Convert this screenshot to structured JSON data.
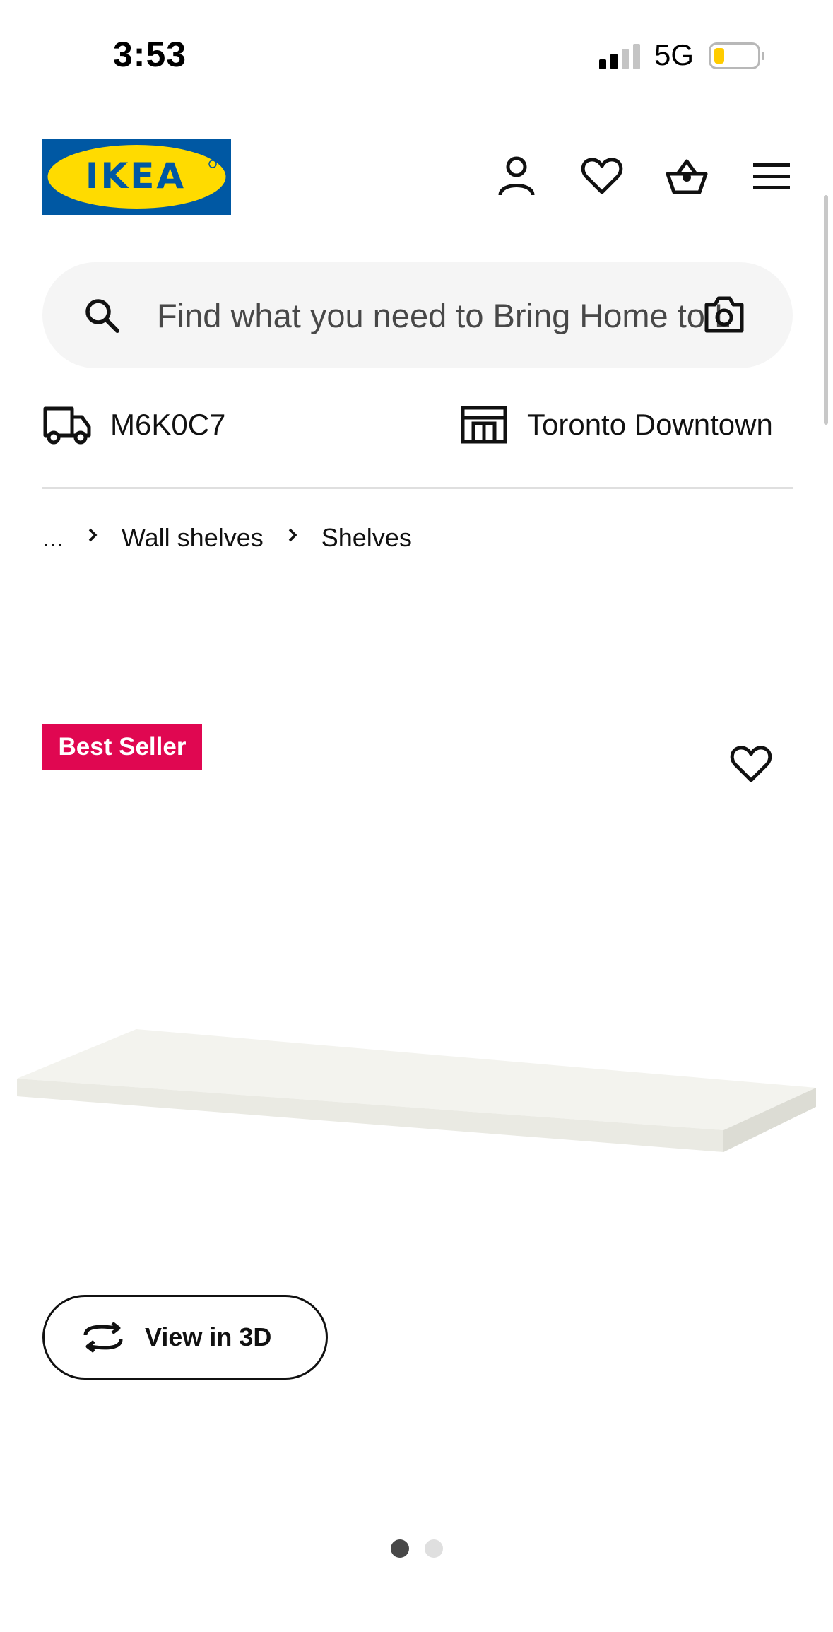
{
  "status_bar": {
    "time": "3:53",
    "network": "5G",
    "battery_color": "#ffcc00"
  },
  "brand": {
    "logo_text": "IKEA",
    "blue": "#0058a3",
    "yellow": "#ffdb00"
  },
  "header": {
    "icons": [
      "account-icon",
      "favourites-icon",
      "shopping-cart-icon",
      "menu-icon"
    ]
  },
  "search": {
    "placeholder": "Find what you need to Bring Home to Life"
  },
  "location": {
    "postal_code": "M6K0C7",
    "store": "Toronto Downtown"
  },
  "breadcrumb": {
    "ellipsis": "...",
    "items": [
      "Wall shelves",
      "Shelves"
    ]
  },
  "product": {
    "badge": "Best Seller",
    "badge_color": "#e00751",
    "view_3d_label": "View in 3D"
  },
  "carousel": {
    "total": 2,
    "active": 1
  }
}
